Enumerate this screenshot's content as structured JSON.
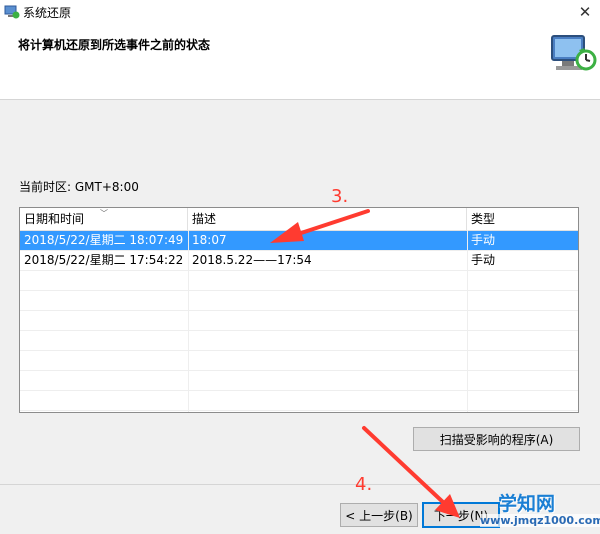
{
  "window": {
    "title": "系统还原",
    "close_glyph": "✕"
  },
  "header": {
    "title": "将计算机还原到所选事件之前的状态",
    "icon": "system-restore-icon"
  },
  "timezone": "当前时区: GMT+8:00",
  "table": {
    "columns": [
      "日期和时间",
      "描述",
      "类型"
    ],
    "rows": [
      {
        "datetime": "2018/5/22/星期二 18:07:49",
        "description": "18:07",
        "type": "手动",
        "selected": true
      },
      {
        "datetime": "2018/5/22/星期二 17:54:22",
        "description": "2018.5.22——17:54",
        "type": "手动",
        "selected": false
      }
    ]
  },
  "buttons": {
    "scan": "扫描受影响的程序(A)",
    "back": "< 上一步(B)",
    "next": "下一步(N)"
  },
  "annotations": {
    "step3": "3.",
    "step4": "4."
  },
  "watermark": {
    "name": "学知网",
    "url": "www.jmqz1000.com"
  },
  "colors": {
    "selection": "#3399ff",
    "annotation": "#ff3b30",
    "default_button_border": "#0078d7"
  }
}
